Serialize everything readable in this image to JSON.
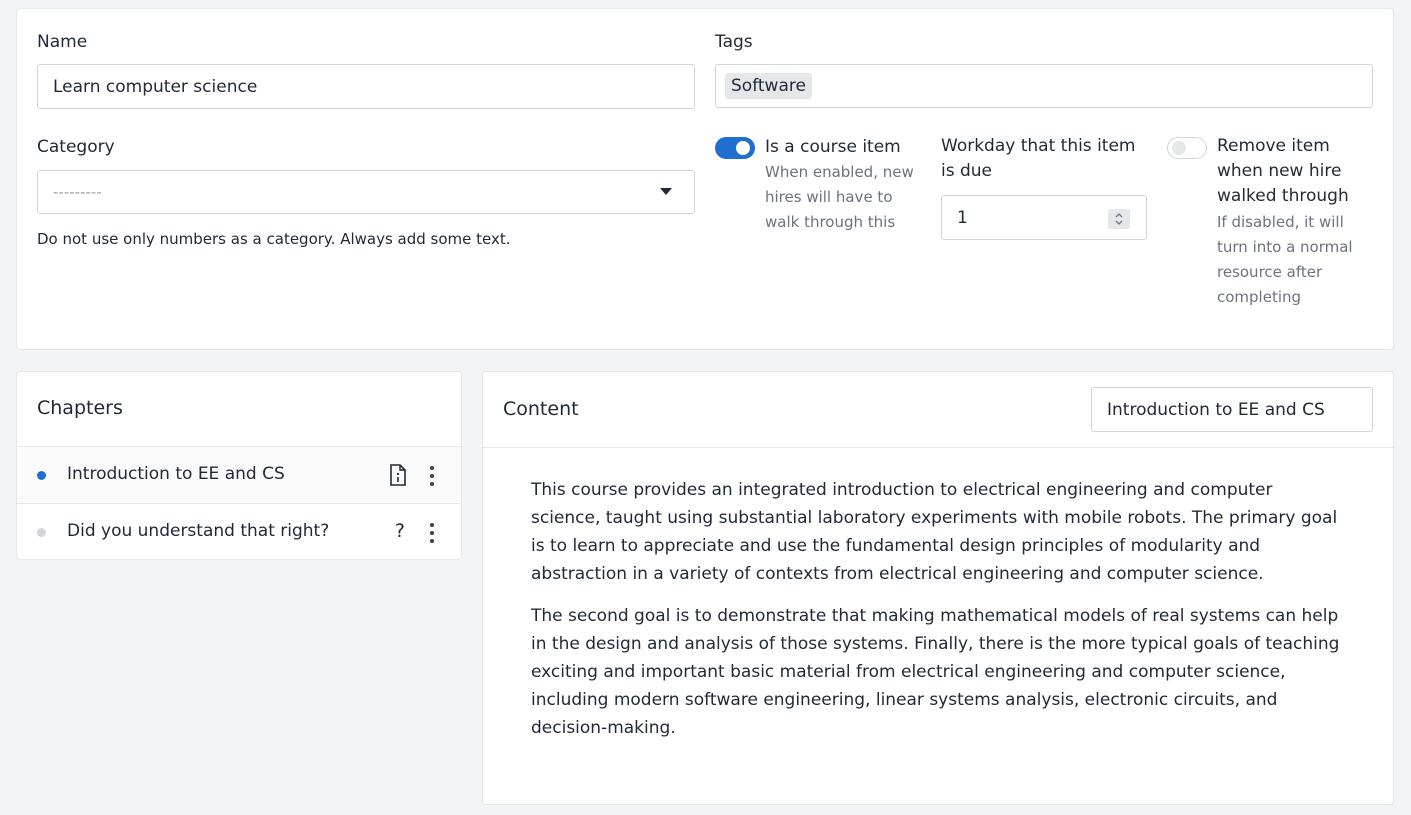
{
  "form": {
    "name_label": "Name",
    "name_value": "Learn computer science",
    "tags_label": "Tags",
    "tags": [
      "Software"
    ],
    "category_label": "Category",
    "category_placeholder": "---------",
    "category_help": "Do not use only numbers as a category. Always add some text.",
    "course_item": {
      "label": "Is a course item",
      "description": "When enabled, new hires will have to walk through this",
      "enabled": true
    },
    "workday": {
      "label": "Workday that this item is due",
      "value": "1"
    },
    "remove_item": {
      "label": "Remove item when new hire walked through",
      "description": "If disabled, it will turn into a normal resource after completing",
      "enabled": false
    }
  },
  "chapters": {
    "title": "Chapters",
    "items": [
      {
        "label": "Introduction to EE and CS",
        "status_color": "#1f6fd1",
        "icon": "file-info-icon"
      },
      {
        "label": "Did you understand that right?",
        "status_color": "#d1d5db",
        "icon": "question-icon",
        "icon_glyph": "?"
      }
    ]
  },
  "content": {
    "title": "Content",
    "chapter_title_value": "Introduction to EE and CS",
    "paragraphs": [
      "This course provides an integrated introduction to electrical engineering and computer science, taught using substantial laboratory experiments with mobile robots. The primary goal is to learn to appreciate and use the fundamental design principles of modularity and abstraction in a variety of contexts from electrical engineering and computer science.",
      "The second goal is to demonstrate that making mathematical models of real systems can help in the design and analysis of those systems. Finally, there is the more typical goals of teaching exciting and important basic material from electrical engineering and computer science, including modern software engineering, linear systems analysis, electronic circuits, and decision-making."
    ]
  },
  "colors": {
    "accent": "#1f6fd1",
    "inactive_dot": "#d1d5db",
    "background": "#f3f4f6"
  }
}
